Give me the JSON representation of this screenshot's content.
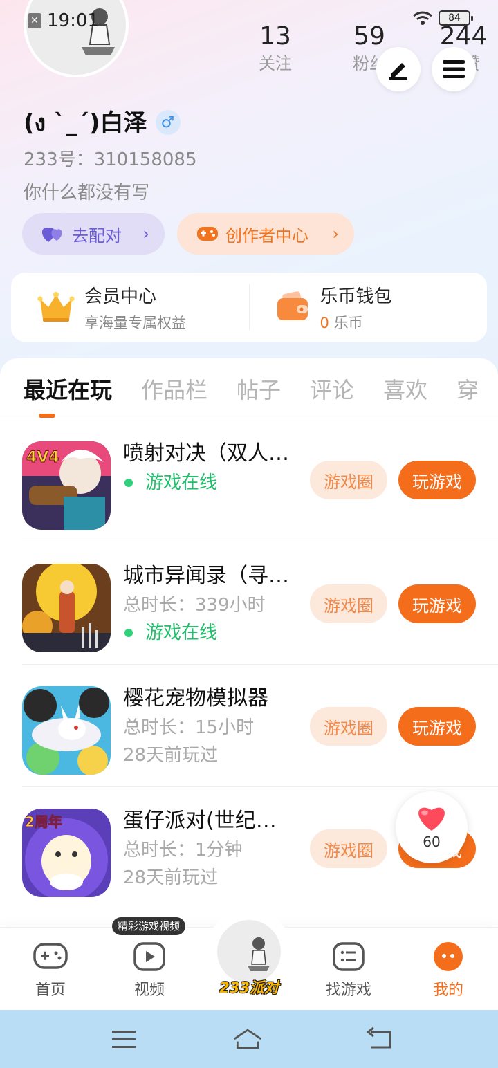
{
  "status_bar": {
    "time": "19:01",
    "battery": "84"
  },
  "profile": {
    "username": "(ง ˋ_ˊ)白泽",
    "gender_symbol": "♂",
    "uid": "233号：310158085",
    "bio": "你什么都没有写",
    "stats": [
      {
        "num": "13",
        "label": "关注"
      },
      {
        "num": "59",
        "label": "粉丝"
      },
      {
        "num": "244",
        "label": "获赞"
      }
    ],
    "actions": {
      "match_label": "去配对",
      "creator_label": "创作者中心"
    }
  },
  "vip": {
    "member_title": "会员中心",
    "member_sub": "享海量专属权益",
    "wallet_title": "乐币钱包",
    "wallet_amount": "0",
    "wallet_unit": "乐币"
  },
  "tabs": [
    "最近在玩",
    "作品栏",
    "帖子",
    "评论",
    "喜欢",
    "穿"
  ],
  "games": [
    {
      "title": "喷射对决（双人…",
      "line1": "",
      "line2": "游戏在线",
      "circle_label": "游戏圈",
      "play_label": "玩游戏"
    },
    {
      "title": "城市异闻录（寻…",
      "line1": "总时长：339小时",
      "line2": "游戏在线",
      "circle_label": "游戏圈",
      "play_label": "玩游戏"
    },
    {
      "title": "樱花宠物模拟器",
      "line1": "总时长：15小时",
      "line2": "28天前玩过",
      "circle_label": "游戏圈",
      "play_label": "玩游戏"
    },
    {
      "title": "蛋仔派对(世纪…",
      "line1": "总时长：1分钟",
      "line2": "28天前玩过",
      "circle_label": "游戏圈",
      "play_label": "玩游戏"
    }
  ],
  "game_icon_text": {
    "jet": "4V4",
    "egg": "2周年"
  },
  "like": {
    "count": "60"
  },
  "bottom_nav": {
    "home": "首页",
    "video": "视频",
    "video_tip": "精彩游戏视频",
    "center_logo": "233派对",
    "find": "找游戏",
    "mine": "我的"
  },
  "colors": {
    "accent": "#f36d1b",
    "online": "#1fbf6b",
    "match": "#6a5bd6"
  }
}
